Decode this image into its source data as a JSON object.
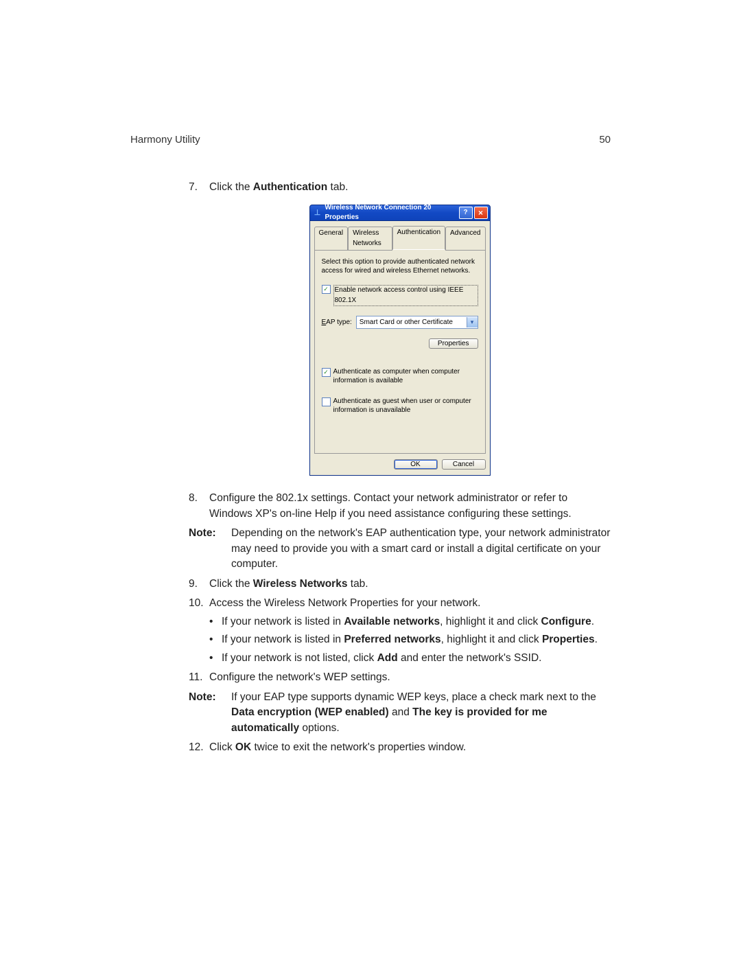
{
  "header": {
    "title": "Harmony Utility",
    "page_number": "50"
  },
  "steps": {
    "s7": {
      "num": "7.",
      "text_pre": "Click the ",
      "bold": "Authentication",
      "text_post": " tab."
    },
    "s8": {
      "num": "8.",
      "text": "Configure the 802.1x settings.  Contact your network administrator or refer to Windows XP's on-line Help if you need assistance configuring these settings."
    },
    "note1": {
      "label": "Note:",
      "text": "Depending on the network's EAP authentication type, your network administrator may need to provide you with a smart card or install a digital certificate on your computer."
    },
    "s9": {
      "num": "9.",
      "text_pre": "Click the ",
      "bold": "Wireless Networks",
      "text_post": " tab."
    },
    "s10": {
      "num": "10.",
      "text": "Access the Wireless Network Properties for your network."
    },
    "b1": {
      "pre": "If your network is listed in ",
      "bold1": "Available networks",
      "mid": ", highlight it and click ",
      "bold2": "Configure",
      "post": "."
    },
    "b2": {
      "pre": "If your network is listed in ",
      "bold1": "Preferred networks",
      "mid": ", highlight it and click ",
      "bold2": "Properties",
      "post": "."
    },
    "b3": {
      "pre": "If your network is not listed, click ",
      "bold1": "Add",
      "post": " and enter the network's SSID."
    },
    "s11": {
      "num": "11.",
      "text": "Configure the network's WEP settings."
    },
    "note2": {
      "label": "Note:",
      "pre": "If your EAP type supports dynamic WEP keys, place a check mark next to the ",
      "bold1": "Data encryption (WEP enabled)",
      "mid": " and ",
      "bold2": "The key is provided for me automatically",
      "post": " options."
    },
    "s12": {
      "num": "12.",
      "pre": "Click ",
      "bold": "OK",
      "post": " twice to exit the network's properties window."
    }
  },
  "dialog": {
    "title": "Wireless Network Connection 20 Properties",
    "help_symbol": "?",
    "close_symbol": "×",
    "tabs": {
      "general": "General",
      "wireless": "Wireless Networks",
      "auth": "Authentication",
      "advanced": "Advanced"
    },
    "desc": "Select this option to provide authenticated network access for wired and wireless Ethernet networks.",
    "chk_enable": "Enable network access control using IEEE 802.1X",
    "eap_label": "EAP type:",
    "eap_value": "Smart Card or other Certificate",
    "properties_btn": "Properties",
    "chk_computer": "Authenticate as computer when computer information is available",
    "chk_guest": "Authenticate as guest when user or computer information is unavailable",
    "ok": "OK",
    "cancel": "Cancel"
  }
}
